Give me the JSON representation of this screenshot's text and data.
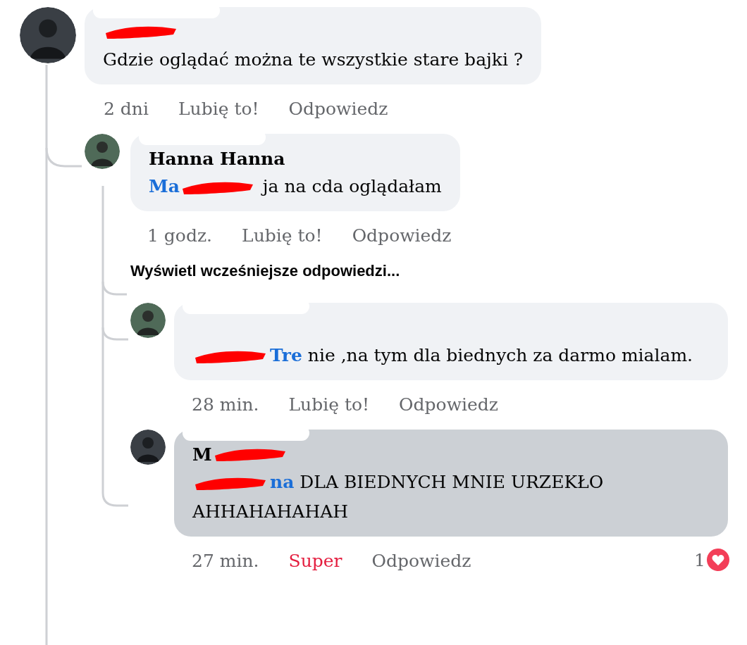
{
  "thread": [
    {
      "kind": "comment",
      "highlighted": false,
      "author_scribbled": true,
      "text": "Gdzie oglądać można te wszystkie stare bajki ?",
      "time": "2 dni",
      "like": {
        "label": "Lubię to!",
        "reacted": false
      },
      "reply": "Odpowiedz",
      "children": [
        {
          "kind": "comment",
          "highlighted": false,
          "author_scribbled": false,
          "author": "Hanna Hanna",
          "mention": {
            "start": "Ma"
          },
          "text": "ja na cda oglądałam",
          "time": "1 godz.",
          "like": {
            "label": "Lubię to!",
            "reacted": false
          },
          "reply": "Odpowiedz",
          "children": [
            {
              "kind": "more",
              "label": "Wyświetl wcześniejsze odpowiedzi..."
            },
            {
              "kind": "comment",
              "highlighted": false,
              "author_scribbled": false,
              "mention": {
                "end": "Tre"
              },
              "text": "nie ,na tym dla biednych za darmo mialam.",
              "time": "28 min.",
              "like": {
                "label": "Lubię to!",
                "reacted": false
              },
              "reply": "Odpowiedz"
            },
            {
              "kind": "comment",
              "highlighted": true,
              "author_scribbled": true,
              "author": "M",
              "mention": {
                "end": "na"
              },
              "text": "DLA BIEDNYCH MNIE URZEKŁO AHHAHAHAHAH",
              "time": "27 min.",
              "like": {
                "label": "Super",
                "reacted": true
              },
              "reply": "Odpowiedz",
              "reactions": {
                "count": "1"
              }
            }
          ]
        }
      ]
    }
  ]
}
